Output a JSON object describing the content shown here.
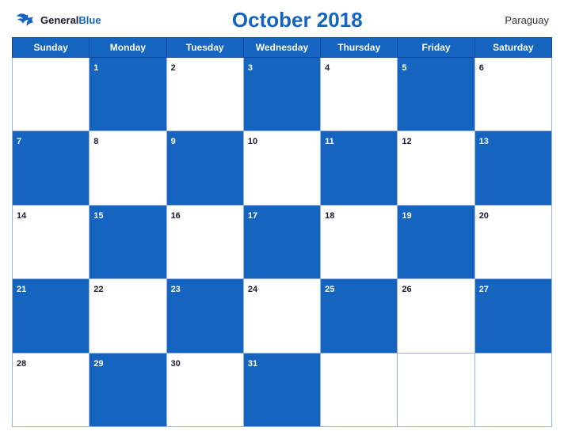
{
  "header": {
    "logo_general": "General",
    "logo_blue": "Blue",
    "title": "October 2018",
    "country": "Paraguay"
  },
  "weekdays": [
    "Sunday",
    "Monday",
    "Tuesday",
    "Wednesday",
    "Thursday",
    "Friday",
    "Saturday"
  ],
  "weeks": [
    [
      {
        "day": "",
        "blue": false,
        "empty": true
      },
      {
        "day": "1",
        "blue": true
      },
      {
        "day": "2",
        "blue": false
      },
      {
        "day": "3",
        "blue": true
      },
      {
        "day": "4",
        "blue": false
      },
      {
        "day": "5",
        "blue": true
      },
      {
        "day": "6",
        "blue": false
      }
    ],
    [
      {
        "day": "7",
        "blue": true
      },
      {
        "day": "8",
        "blue": false
      },
      {
        "day": "9",
        "blue": true
      },
      {
        "day": "10",
        "blue": false
      },
      {
        "day": "11",
        "blue": true
      },
      {
        "day": "12",
        "blue": false
      },
      {
        "day": "13",
        "blue": true
      }
    ],
    [
      {
        "day": "14",
        "blue": false
      },
      {
        "day": "15",
        "blue": true
      },
      {
        "day": "16",
        "blue": false
      },
      {
        "day": "17",
        "blue": true
      },
      {
        "day": "18",
        "blue": false
      },
      {
        "day": "19",
        "blue": true
      },
      {
        "day": "20",
        "blue": false
      }
    ],
    [
      {
        "day": "21",
        "blue": true
      },
      {
        "day": "22",
        "blue": false
      },
      {
        "day": "23",
        "blue": true
      },
      {
        "day": "24",
        "blue": false
      },
      {
        "day": "25",
        "blue": true
      },
      {
        "day": "26",
        "blue": false
      },
      {
        "day": "27",
        "blue": true
      }
    ],
    [
      {
        "day": "28",
        "blue": false
      },
      {
        "day": "29",
        "blue": true
      },
      {
        "day": "30",
        "blue": false
      },
      {
        "day": "31",
        "blue": true
      },
      {
        "day": "",
        "blue": false,
        "empty": true
      },
      {
        "day": "",
        "blue": false,
        "empty": true
      },
      {
        "day": "",
        "blue": false,
        "empty": true
      }
    ]
  ]
}
